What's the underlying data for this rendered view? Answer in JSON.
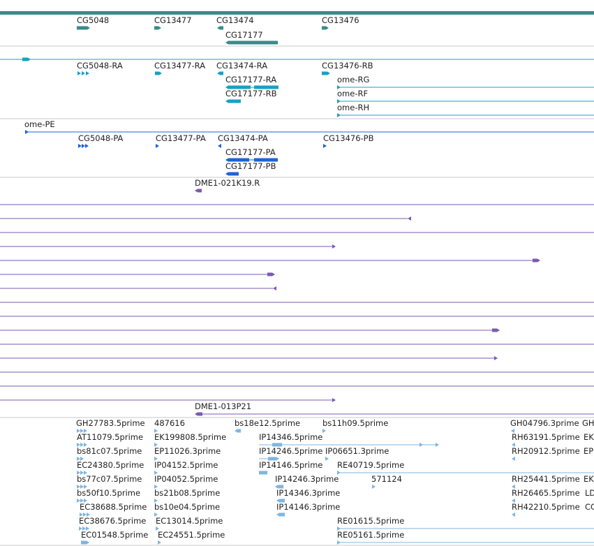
{
  "colors": {
    "gene": "#3a8a8a",
    "transcript": "#1aa0c4",
    "protein": "#1f63d4",
    "clone": "#7a5bb0",
    "est": "#7fb5e0",
    "separator": "#c8c8c8"
  },
  "gene_labels": [
    "CG5048",
    "CG13477",
    "CG13474",
    "CG13476",
    "CG17177"
  ],
  "transcript_labels": [
    "CG5048-RA",
    "CG13477-RA",
    "CG13474-RA",
    "CG13476-RB",
    "CG17177-RA",
    "CG17177-RB",
    "ome-RG",
    "ome-RF",
    "ome-RH"
  ],
  "protein_labels": [
    "ome-PE",
    "CG5048-PA",
    "CG13477-PA",
    "CG13474-PA",
    "CG13476-PB",
    "CG17177-PA",
    "CG17177-PB"
  ],
  "clone_labels": [
    "DME1-021K19.R",
    "DME1-013P21"
  ],
  "est_labels": [
    "GH27783.5prime",
    "487616",
    "bs18e12.5prime",
    "bs11h09.5prime",
    "GH04796.3prime",
    "GH",
    "AT11079.5prime",
    "EK199808.5prime",
    "IP14346.5prime",
    "RH63191.5prime",
    "EK",
    "bs81c07.5prime",
    "EP11026.3prime",
    "IP14246.5prime",
    "IP06651.3prime",
    "RH20912.5prime",
    "EP",
    "EC24380.5prime",
    "IP04152.5prime",
    "IP14146.5prime",
    "RE40719.5prime",
    "bs77c07.5prime",
    "IP04052.5prime",
    "IP14246.3prime",
    "571124",
    "RH25441.5prime",
    "EK",
    "bs50f10.5prime",
    "bs21b08.5prime",
    "IP14346.3prime",
    "RH26465.5prime",
    "LD",
    "EC38688.5prime",
    "bs10e04.5prime",
    "IP14146.3prime",
    "RH42210.5prime",
    "CC",
    "EC38676.5prime",
    "EC13014.5prime",
    "RE01615.5prime",
    "EC01548.5prime",
    "EC24551.5prime",
    "RE05161.5prime"
  ]
}
